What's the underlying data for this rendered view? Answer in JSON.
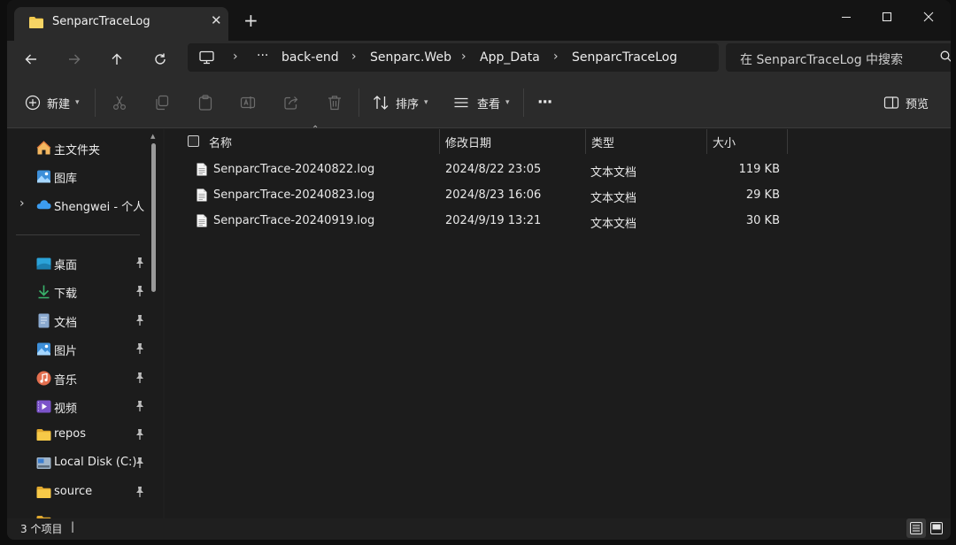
{
  "tab": {
    "title": "SenparcTraceLog",
    "close": "✕",
    "new_tab": "+"
  },
  "window_controls": {
    "minimize": "─",
    "maximize": "☐",
    "close": "✕"
  },
  "address": {
    "overflow": "···",
    "breadcrumbs": [
      "back-end",
      "Senparc.Web",
      "App_Data",
      "SenparcTraceLog"
    ],
    "separator": "›"
  },
  "search": {
    "placeholder": "在 SenparcTraceLog 中搜索"
  },
  "toolbar": {
    "new_label": "新建",
    "sort_label": "排序",
    "view_label": "查看",
    "more_label": "···",
    "preview_label": "预览"
  },
  "sidebar": {
    "items": [
      {
        "label": "主文件夹",
        "icon": "home-icon"
      },
      {
        "label": "图库",
        "icon": "gallery-icon"
      },
      {
        "label": "Shengwei - 个人",
        "icon": "onedrive-icon"
      },
      {
        "label": "桌面",
        "icon": "desktop-icon"
      },
      {
        "label": "下载",
        "icon": "download-icon"
      },
      {
        "label": "文档",
        "icon": "documents-icon"
      },
      {
        "label": "图片",
        "icon": "pictures-icon"
      },
      {
        "label": "音乐",
        "icon": "music-icon"
      },
      {
        "label": "视频",
        "icon": "videos-icon"
      },
      {
        "label": "repos",
        "icon": "folder-icon"
      },
      {
        "label": "Local Disk (C:)",
        "icon": "disk-icon"
      },
      {
        "label": "source",
        "icon": "folder-icon"
      }
    ],
    "expand": "›"
  },
  "columns": {
    "name": "名称",
    "modified": "修改日期",
    "type": "类型",
    "size": "大小"
  },
  "files": [
    {
      "name": "SenparcTrace-20240822.log",
      "modified": "2024/8/22 23:05",
      "type": "文本文档",
      "size": "119 KB"
    },
    {
      "name": "SenparcTrace-20240823.log",
      "modified": "2024/8/23 16:06",
      "type": "文本文档",
      "size": "29 KB"
    },
    {
      "name": "SenparcTrace-20240919.log",
      "modified": "2024/9/19 13:21",
      "type": "文本文档",
      "size": "30 KB"
    }
  ],
  "status": {
    "count": "3 个项目",
    "cursor": "|"
  },
  "colors": {
    "accent": "#4cc2ff",
    "folder": "#f2c94c",
    "window_bg": "#1f1f1f",
    "bar_bg": "#2b2b2b"
  }
}
